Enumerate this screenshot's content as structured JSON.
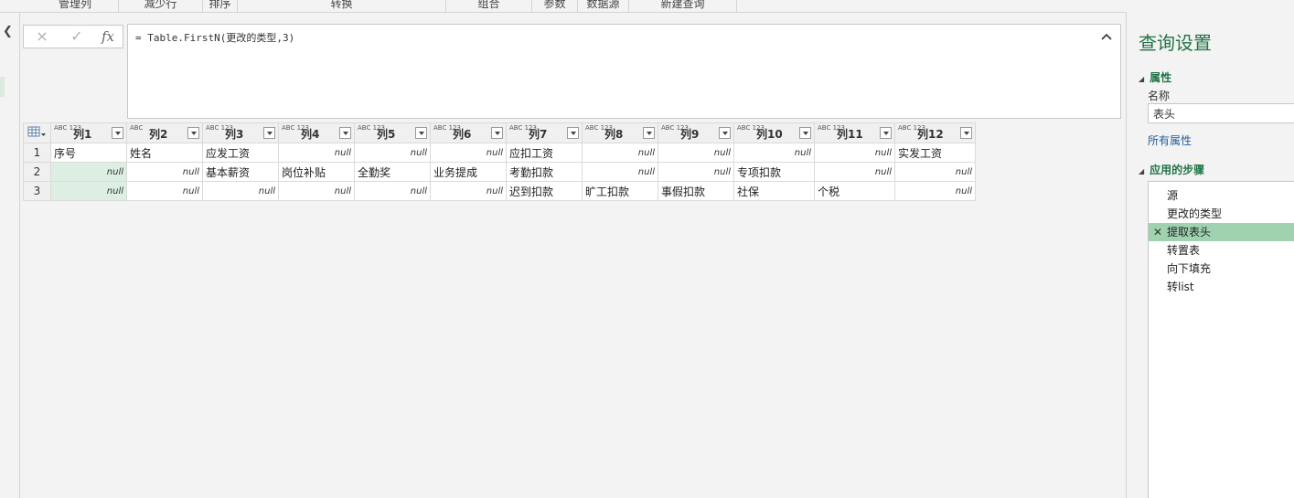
{
  "ribbon": {
    "groups": [
      "管理列",
      "减少行",
      "排序",
      "转换",
      "组合",
      "参数",
      "数据源",
      "新建查询"
    ]
  },
  "formula_bar": {
    "cancel_icon": "×",
    "confirm_icon": "✓",
    "fx_label": "fx",
    "formula": "= Table.FirstN(更改的类型,3)"
  },
  "grid": {
    "columns": [
      {
        "label": "列1",
        "type": "ABC 123"
      },
      {
        "label": "列2",
        "type": "ABC"
      },
      {
        "label": "列3",
        "type": "ABC 123"
      },
      {
        "label": "列4",
        "type": "ABC 123"
      },
      {
        "label": "列5",
        "type": "ABC 123"
      },
      {
        "label": "列6",
        "type": "ABC 123"
      },
      {
        "label": "列7",
        "type": "ABC 123"
      },
      {
        "label": "列8",
        "type": "ABC 123"
      },
      {
        "label": "列9",
        "type": "ABC 123"
      },
      {
        "label": "列10",
        "type": "ABC 123"
      },
      {
        "label": "列11",
        "type": "ABC 123"
      },
      {
        "label": "列12",
        "type": "ABC 123"
      }
    ],
    "rows": [
      {
        "num": "1",
        "cells": [
          "序号",
          "姓名",
          "应发工资",
          "null",
          "null",
          "null",
          "应扣工资",
          "null",
          "null",
          "null",
          "null",
          "实发工资"
        ]
      },
      {
        "num": "2",
        "cells": [
          "null",
          "null",
          "基本薪资",
          "岗位补贴",
          "全勤奖",
          "业务提成",
          "考勤扣款",
          "null",
          "null",
          "专项扣款",
          "null",
          "null"
        ]
      },
      {
        "num": "3",
        "cells": [
          "null",
          "null",
          "null",
          "null",
          "null",
          "null",
          "迟到扣款",
          "旷工扣款",
          "事假扣款",
          "社保",
          "个税",
          "null"
        ]
      }
    ]
  },
  "panel": {
    "title": "查询设置",
    "properties_title": "属性",
    "name_label": "名称",
    "name_value": "表头",
    "all_properties": "所有属性",
    "steps_title": "应用的步骤",
    "steps": [
      "源",
      "更改的类型",
      "提取表头",
      "转置表",
      "向下填充",
      "转list"
    ],
    "active_step": "提取表头"
  },
  "colors": {
    "accent": "#217346",
    "selected_column": "#dcefe2",
    "active_step": "#9fd3b0"
  }
}
